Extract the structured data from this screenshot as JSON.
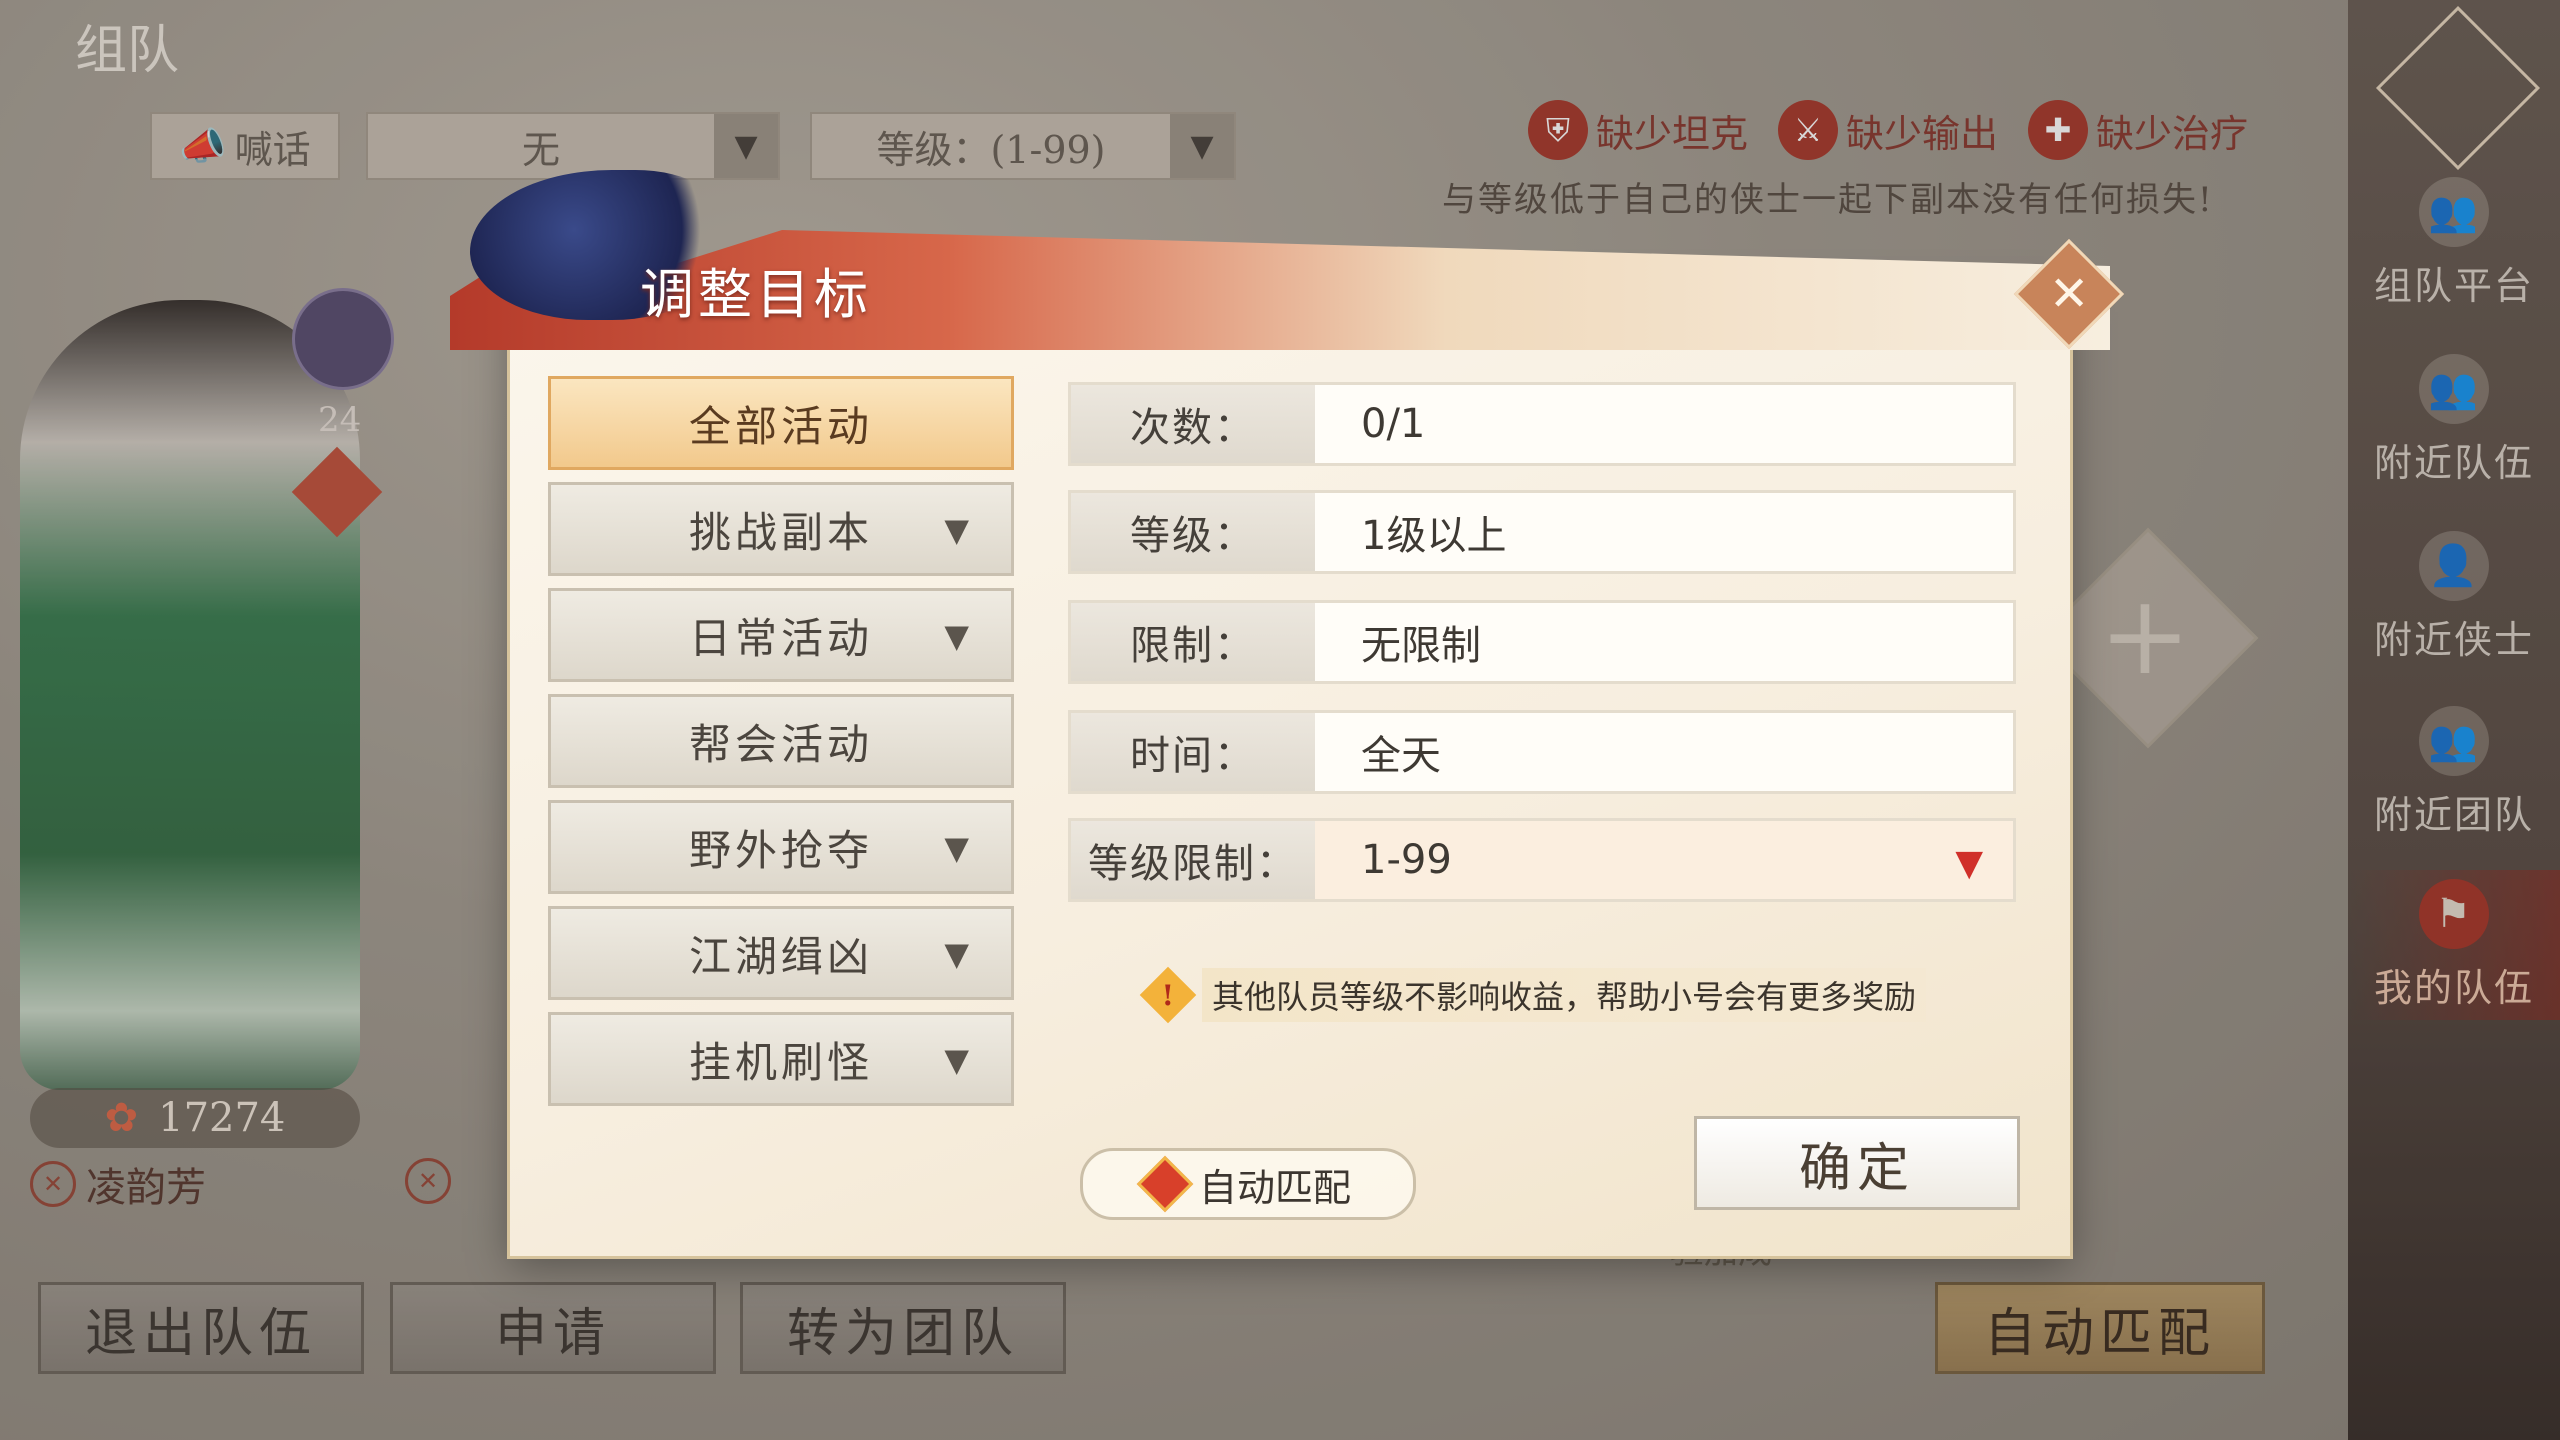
{
  "screen_title": "组队",
  "top_bar": {
    "shout_label": "喊话",
    "target_select": "无",
    "level_select": "等级：(1-99)"
  },
  "lack_roles": [
    "缺少坦克",
    "缺少输出",
    "缺少治疗"
  ],
  "top_tip": "与等级低于自己的侠士一起下副本没有任何损失!",
  "right_nav": [
    {
      "label": "组队平台",
      "icon": "team-platform-icon"
    },
    {
      "label": "附近队伍",
      "icon": "nearby-teams-icon"
    },
    {
      "label": "附近侠士",
      "icon": "nearby-players-icon"
    },
    {
      "label": "附近团队",
      "icon": "nearby-raids-icon"
    },
    {
      "label": "我的队伍",
      "icon": "my-team-icon",
      "active": true
    }
  ],
  "player": {
    "level": "24",
    "power": "17274",
    "name": "凌韵芳"
  },
  "bottom_buttons": {
    "leave": "退出队伍",
    "apply": "申请",
    "convert": "转为团队",
    "auto_match": "自动匹配"
  },
  "exp_hint": "验加成",
  "modal": {
    "title": "调整目标",
    "categories": [
      {
        "label": "全部活动",
        "selected": true,
        "has_arrow": false
      },
      {
        "label": "挑战副本",
        "has_arrow": true
      },
      {
        "label": "日常活动",
        "has_arrow": true
      },
      {
        "label": "帮会活动",
        "has_arrow": false
      },
      {
        "label": "野外抢夺",
        "has_arrow": true
      },
      {
        "label": "江湖缉凶",
        "has_arrow": true
      },
      {
        "label": "挂机刷怪",
        "has_arrow": true
      }
    ],
    "details": [
      {
        "label": "次数：",
        "value": "0/1"
      },
      {
        "label": "等级：",
        "value": "1级以上"
      },
      {
        "label": "限制：",
        "value": "无限制"
      },
      {
        "label": "时间：",
        "value": "全天"
      },
      {
        "label": "等级限制：",
        "value": "1-99",
        "dropdown": true
      }
    ],
    "notice": "其他队员等级不影响收益，帮助小号会有更多奖励",
    "auto_match_label": "自动匹配",
    "confirm_label": "确定"
  },
  "colors": {
    "accent_red": "#c0392b",
    "selected_gold": "#f2c98c",
    "dropdown_arrow": "#d0302a"
  }
}
